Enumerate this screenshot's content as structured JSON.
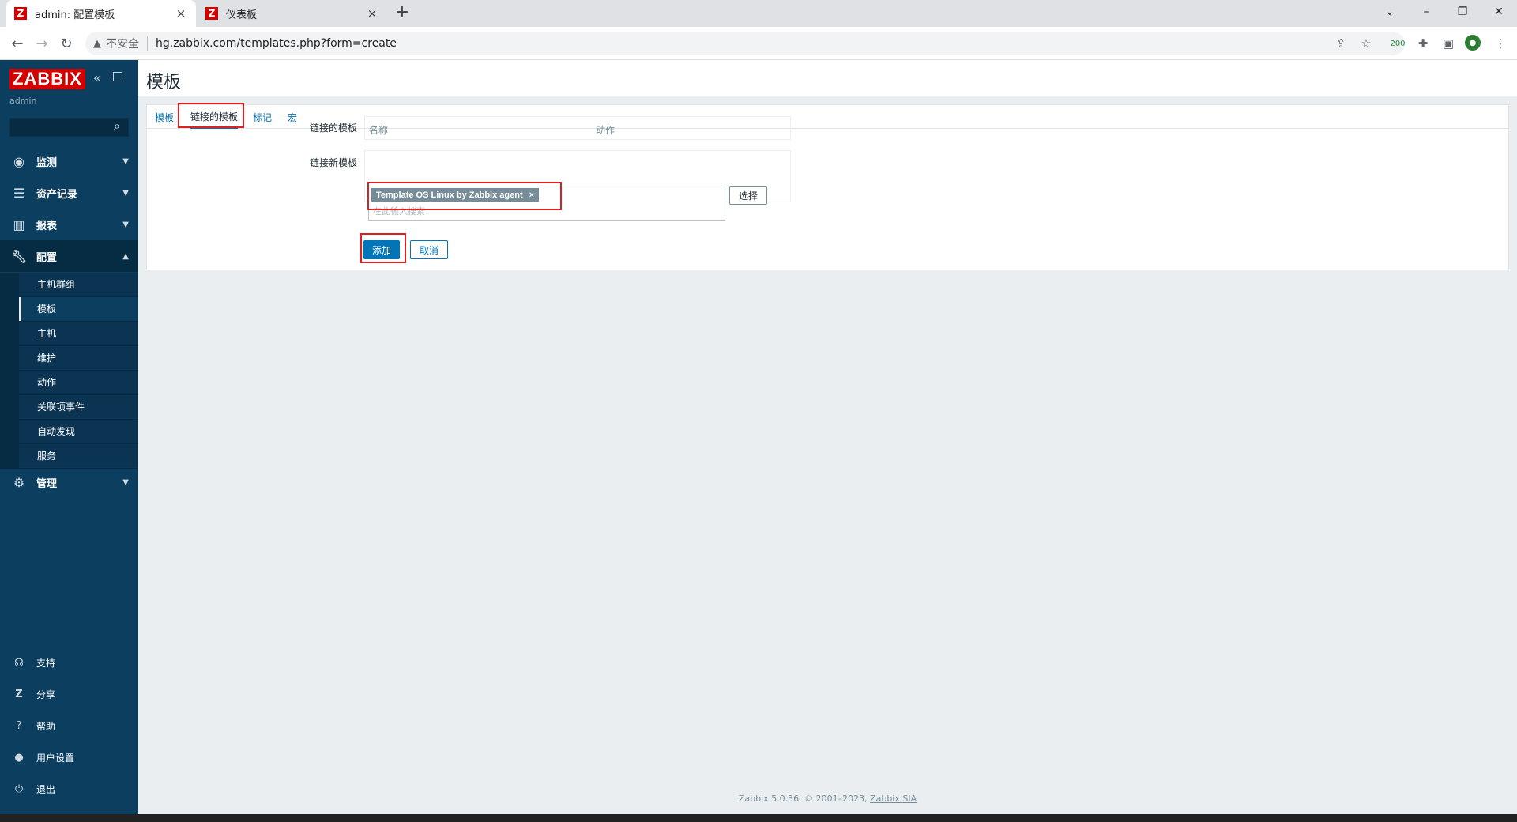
{
  "browser": {
    "tabs": [
      {
        "title": "admin: 配置模板",
        "favicon": "Z",
        "close": "×"
      },
      {
        "title": "仪表板",
        "favicon": "Z",
        "close": "×"
      }
    ],
    "new_tab": "+",
    "security_label": "不安全",
    "url": "hg.zabbix.com/templates.php?form=create",
    "badge": "200"
  },
  "sidebar": {
    "logo": "ZABBIX",
    "user": "admin",
    "menu": [
      {
        "label": "监测",
        "icon": "eye-icon"
      },
      {
        "label": "资产记录",
        "icon": "list-icon"
      },
      {
        "label": "报表",
        "icon": "chart-icon"
      },
      {
        "label": "配置",
        "icon": "wrench-icon"
      },
      {
        "label": "管理",
        "icon": "gear-icon"
      }
    ],
    "submenu": [
      "主机群组",
      "模板",
      "主机",
      "维护",
      "动作",
      "关联项事件",
      "自动发现",
      "服务"
    ],
    "bottom": [
      {
        "label": "支持",
        "icon": "headset-icon"
      },
      {
        "label": "分享",
        "icon": "share-icon"
      },
      {
        "label": "帮助",
        "icon": "help-icon"
      },
      {
        "label": "用户设置",
        "icon": "user-icon"
      },
      {
        "label": "退出",
        "icon": "power-icon"
      }
    ]
  },
  "page": {
    "title": "模板",
    "tabs": [
      "模板",
      "链接的模板",
      "标记",
      "宏"
    ],
    "linked_templates_label": "链接的模板",
    "col_name": "名称",
    "col_action": "动作",
    "link_new_label": "链接新模板",
    "chip": "Template OS Linux by Zabbix agent",
    "chip_remove": "×",
    "placeholder": "在此输入搜索",
    "select_btn": "选择",
    "add_btn": "添加",
    "cancel_btn": "取消"
  },
  "footer": {
    "text": "Zabbix 5.0.36. © 2001–2023, ",
    "link": "Zabbix SIA"
  }
}
